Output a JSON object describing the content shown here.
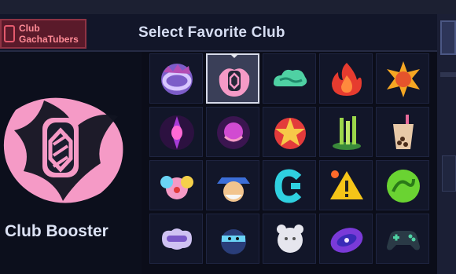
{
  "header": {
    "club_badge_line1": "Club",
    "club_badge_line2": "GachaTubers",
    "title": "Select Favorite Club"
  },
  "left_panel": {
    "label": "Club Booster"
  },
  "grid": {
    "selected_index": 1,
    "rows": 4,
    "cols": 5,
    "emblems": [
      "ring-emblem-icon",
      "crystal-emblem-icon",
      "cloud-emblem-icon",
      "flame-emblem-icon",
      "sun-emblem-icon",
      "eye-emblem-icon",
      "orb-emblem-icon",
      "star-medal-emblem-icon",
      "bamboo-emblem-icon",
      "bubble-tea-emblem-icon",
      "clown-emblem-icon",
      "captain-emblem-icon",
      "c-logo-emblem-icon",
      "warning-emblem-icon",
      "dragon-emblem-icon",
      "sleep-mask-emblem-icon",
      "ninja-emblem-icon",
      "bear-emblem-icon",
      "galaxy-emblem-icon",
      "gamepad-emblem-icon"
    ]
  },
  "colors": {
    "background": "#0b0d19",
    "panel": "#121629",
    "accent_pink": "#f59ac6",
    "badge_red": "#e35a6d",
    "title_text": "#d6ddf2"
  }
}
